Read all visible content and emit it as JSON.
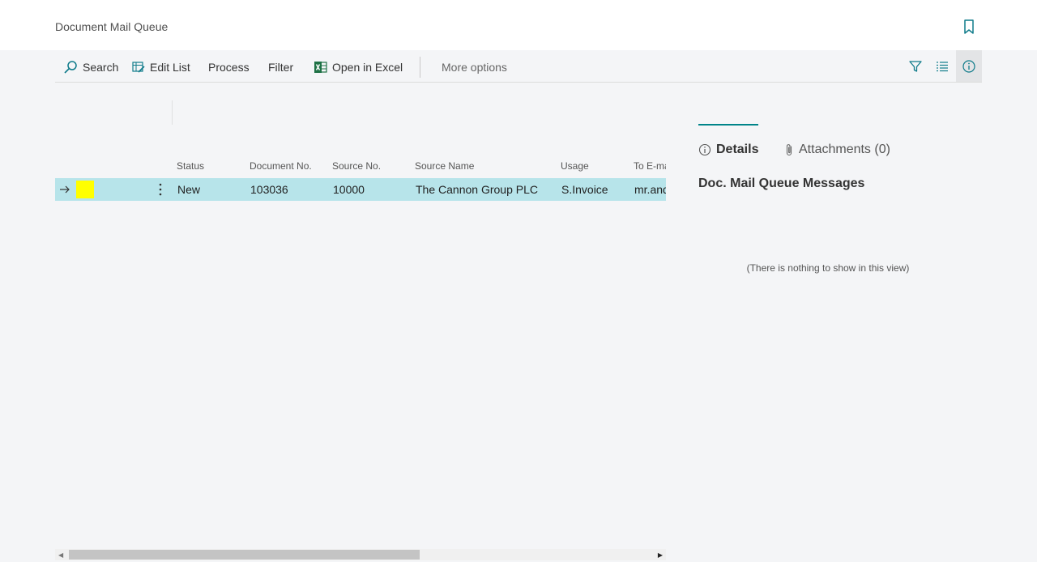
{
  "page": {
    "title": "Document Mail Queue"
  },
  "actions": {
    "search": "Search",
    "edit_list": "Edit List",
    "process": "Process",
    "filter": "Filter",
    "open_in_excel": "Open in Excel",
    "more_options": "More options"
  },
  "grid": {
    "columns": [
      "Status",
      "Document No.",
      "Source No.",
      "Source Name",
      "Usage",
      "To E-ma"
    ],
    "rows": [
      {
        "status": "New",
        "document_no": "103036",
        "source_no": "10000",
        "source_name": "The Cannon Group PLC",
        "usage": "S.Invoice",
        "to_email": "mr.and"
      }
    ]
  },
  "factbox": {
    "tabs": [
      "Details",
      "Attachments (0)"
    ],
    "section_title": "Doc. Mail Queue Messages",
    "empty_text": "(There is nothing to show in this view)"
  },
  "colors": {
    "accent": "#008489",
    "selected_row": "#b7e4ea",
    "marker": "#ffff00",
    "background": "#f4f5f7"
  }
}
